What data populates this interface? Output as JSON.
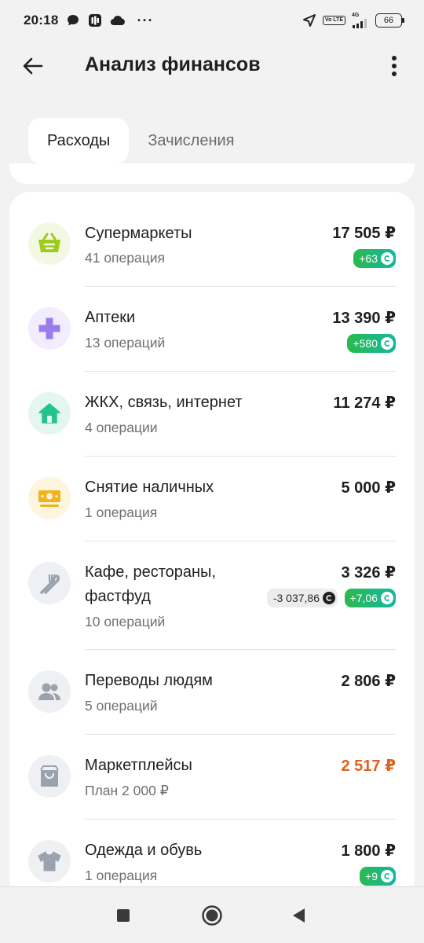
{
  "status_bar": {
    "time": "20:18",
    "volte": "Vo LTE",
    "network": "4G",
    "battery": "66"
  },
  "header": {
    "title": "Анализ финансов"
  },
  "tabs": [
    {
      "label": "Расходы",
      "active": true
    },
    {
      "label": "Зачисления",
      "active": false
    }
  ],
  "categories": [
    {
      "name": "Супермаркеты",
      "subtitle": "41 операция",
      "amount": "17 505 ₽",
      "cashback": [
        "+63"
      ],
      "icon": "basket-icon",
      "icon_color": "#9ccc1c"
    },
    {
      "name": "Аптеки",
      "subtitle": "13 операций",
      "amount": "13 390 ₽",
      "cashback": [
        "+580"
      ],
      "icon": "cross-icon",
      "icon_color": "#9b7bf0"
    },
    {
      "name": "ЖКХ, связь, интернет",
      "subtitle": "4 операции",
      "amount": "11 274 ₽",
      "icon": "house-icon",
      "icon_color": "#24c38e"
    },
    {
      "name": "Снятие наличных",
      "subtitle": "1 операция",
      "amount": "5 000 ₽",
      "icon": "cash-icon",
      "icon_color": "#f2b318"
    },
    {
      "name_line1": "Кафе, рестораны,",
      "name_line2": "фастфуд",
      "subtitle": "10 операций",
      "amount": "3 326 ₽",
      "spent_bonus": "-3 037,86",
      "cashback": [
        "+7,06"
      ],
      "icon": "fork-knife-icon",
      "icon_color": "#9aa2ad"
    },
    {
      "name": "Переводы людям",
      "subtitle": "5 операций",
      "amount": "2 806 ₽",
      "icon": "people-icon",
      "icon_color": "#9aa2ad"
    },
    {
      "name": "Маркетплейсы",
      "subtitle": "План 2 000 ₽",
      "amount": "2 517 ₽",
      "amount_color": "#e0621c",
      "icon": "shopping-bag-icon",
      "icon_color": "#9aa2ad"
    },
    {
      "name": "Одежда и обувь",
      "subtitle": "1 операция",
      "amount": "1 800 ₽",
      "cashback": [
        "+9"
      ],
      "icon": "tshirt-icon",
      "icon_color": "#9aa2ad"
    }
  ],
  "nav": {
    "recent": "square-icon",
    "home": "circle-icon",
    "back": "triangle-back-icon"
  }
}
